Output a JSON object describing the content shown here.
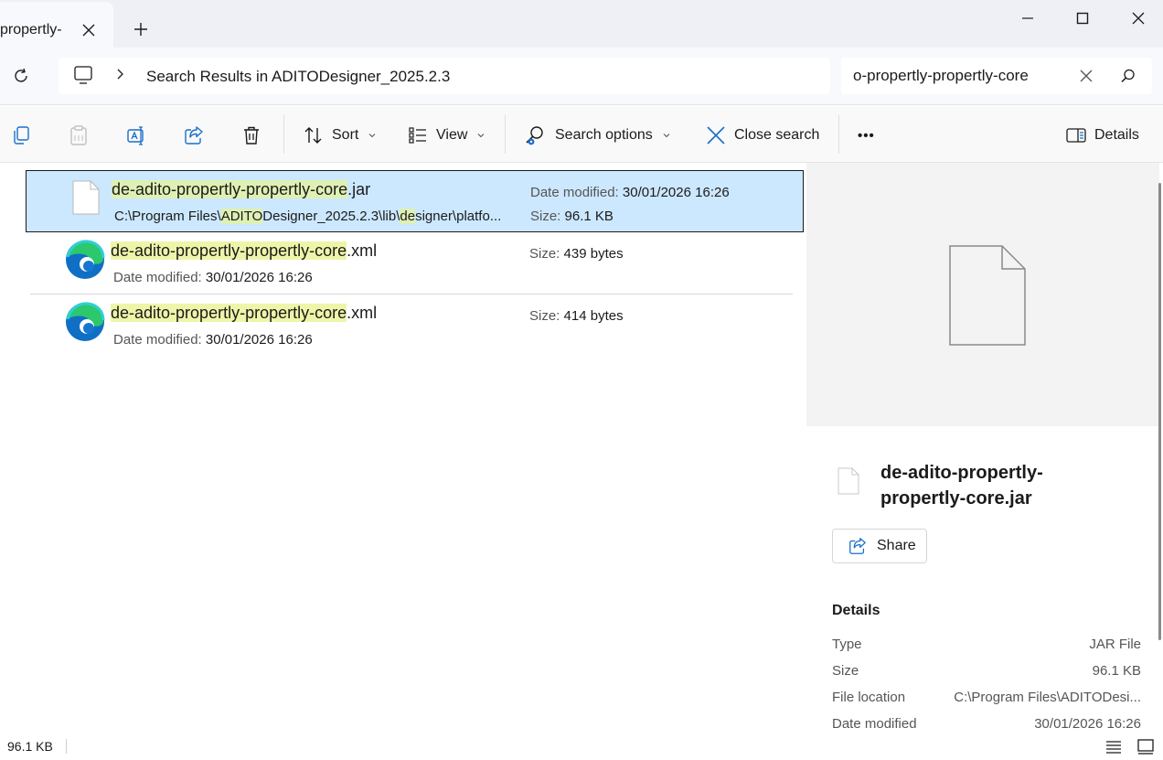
{
  "tab": {
    "title": "propertly-"
  },
  "address": {
    "breadcrumb": "Search Results in ADITODesigner_2025.2.3"
  },
  "search": {
    "value": "o-propertly-propertly-core"
  },
  "toolbar": {
    "sort_label": "Sort",
    "view_label": "View",
    "search_options_label": "Search options",
    "close_search_label": "Close search",
    "more_label": "•••",
    "details_label": "Details"
  },
  "results": [
    {
      "name_match": "de-adito-propertly-propertly-core",
      "name_ext": ".jar",
      "path_parts": [
        "C:\\Program Files\\",
        "ADITO",
        "Designer_2025.2.3\\lib\\",
        "de",
        "signer\\platfo..."
      ],
      "date_label": "Date modified:",
      "date_value": "30/01/2026 16:26",
      "size_label": "Size:",
      "size_value": "96.1 KB"
    },
    {
      "name_match": "de-adito-propertly-propertly-core",
      "name_ext": ".xml",
      "size_label": "Size:",
      "size_value": "439 bytes",
      "date_label": "Date modified:",
      "date_value": "30/01/2026 16:26"
    },
    {
      "name_match": "de-adito-propertly-propertly-core",
      "name_ext": ".xml",
      "size_label": "Size:",
      "size_value": "414 bytes",
      "date_label": "Date modified:",
      "date_value": "30/01/2026 16:26"
    }
  ],
  "details": {
    "file_name": "de-adito-propertly-propertly-core.jar",
    "share_label": "Share",
    "heading": "Details",
    "properties": [
      {
        "key": "Type",
        "value": "JAR File"
      },
      {
        "key": "Size",
        "value": "96.1 KB"
      },
      {
        "key": "File location",
        "value": "C:\\Program Files\\ADITODesi..."
      },
      {
        "key": "Date modified",
        "value": "30/01/2026 16:26"
      }
    ]
  },
  "status": {
    "selection_size": "96.1 KB"
  }
}
